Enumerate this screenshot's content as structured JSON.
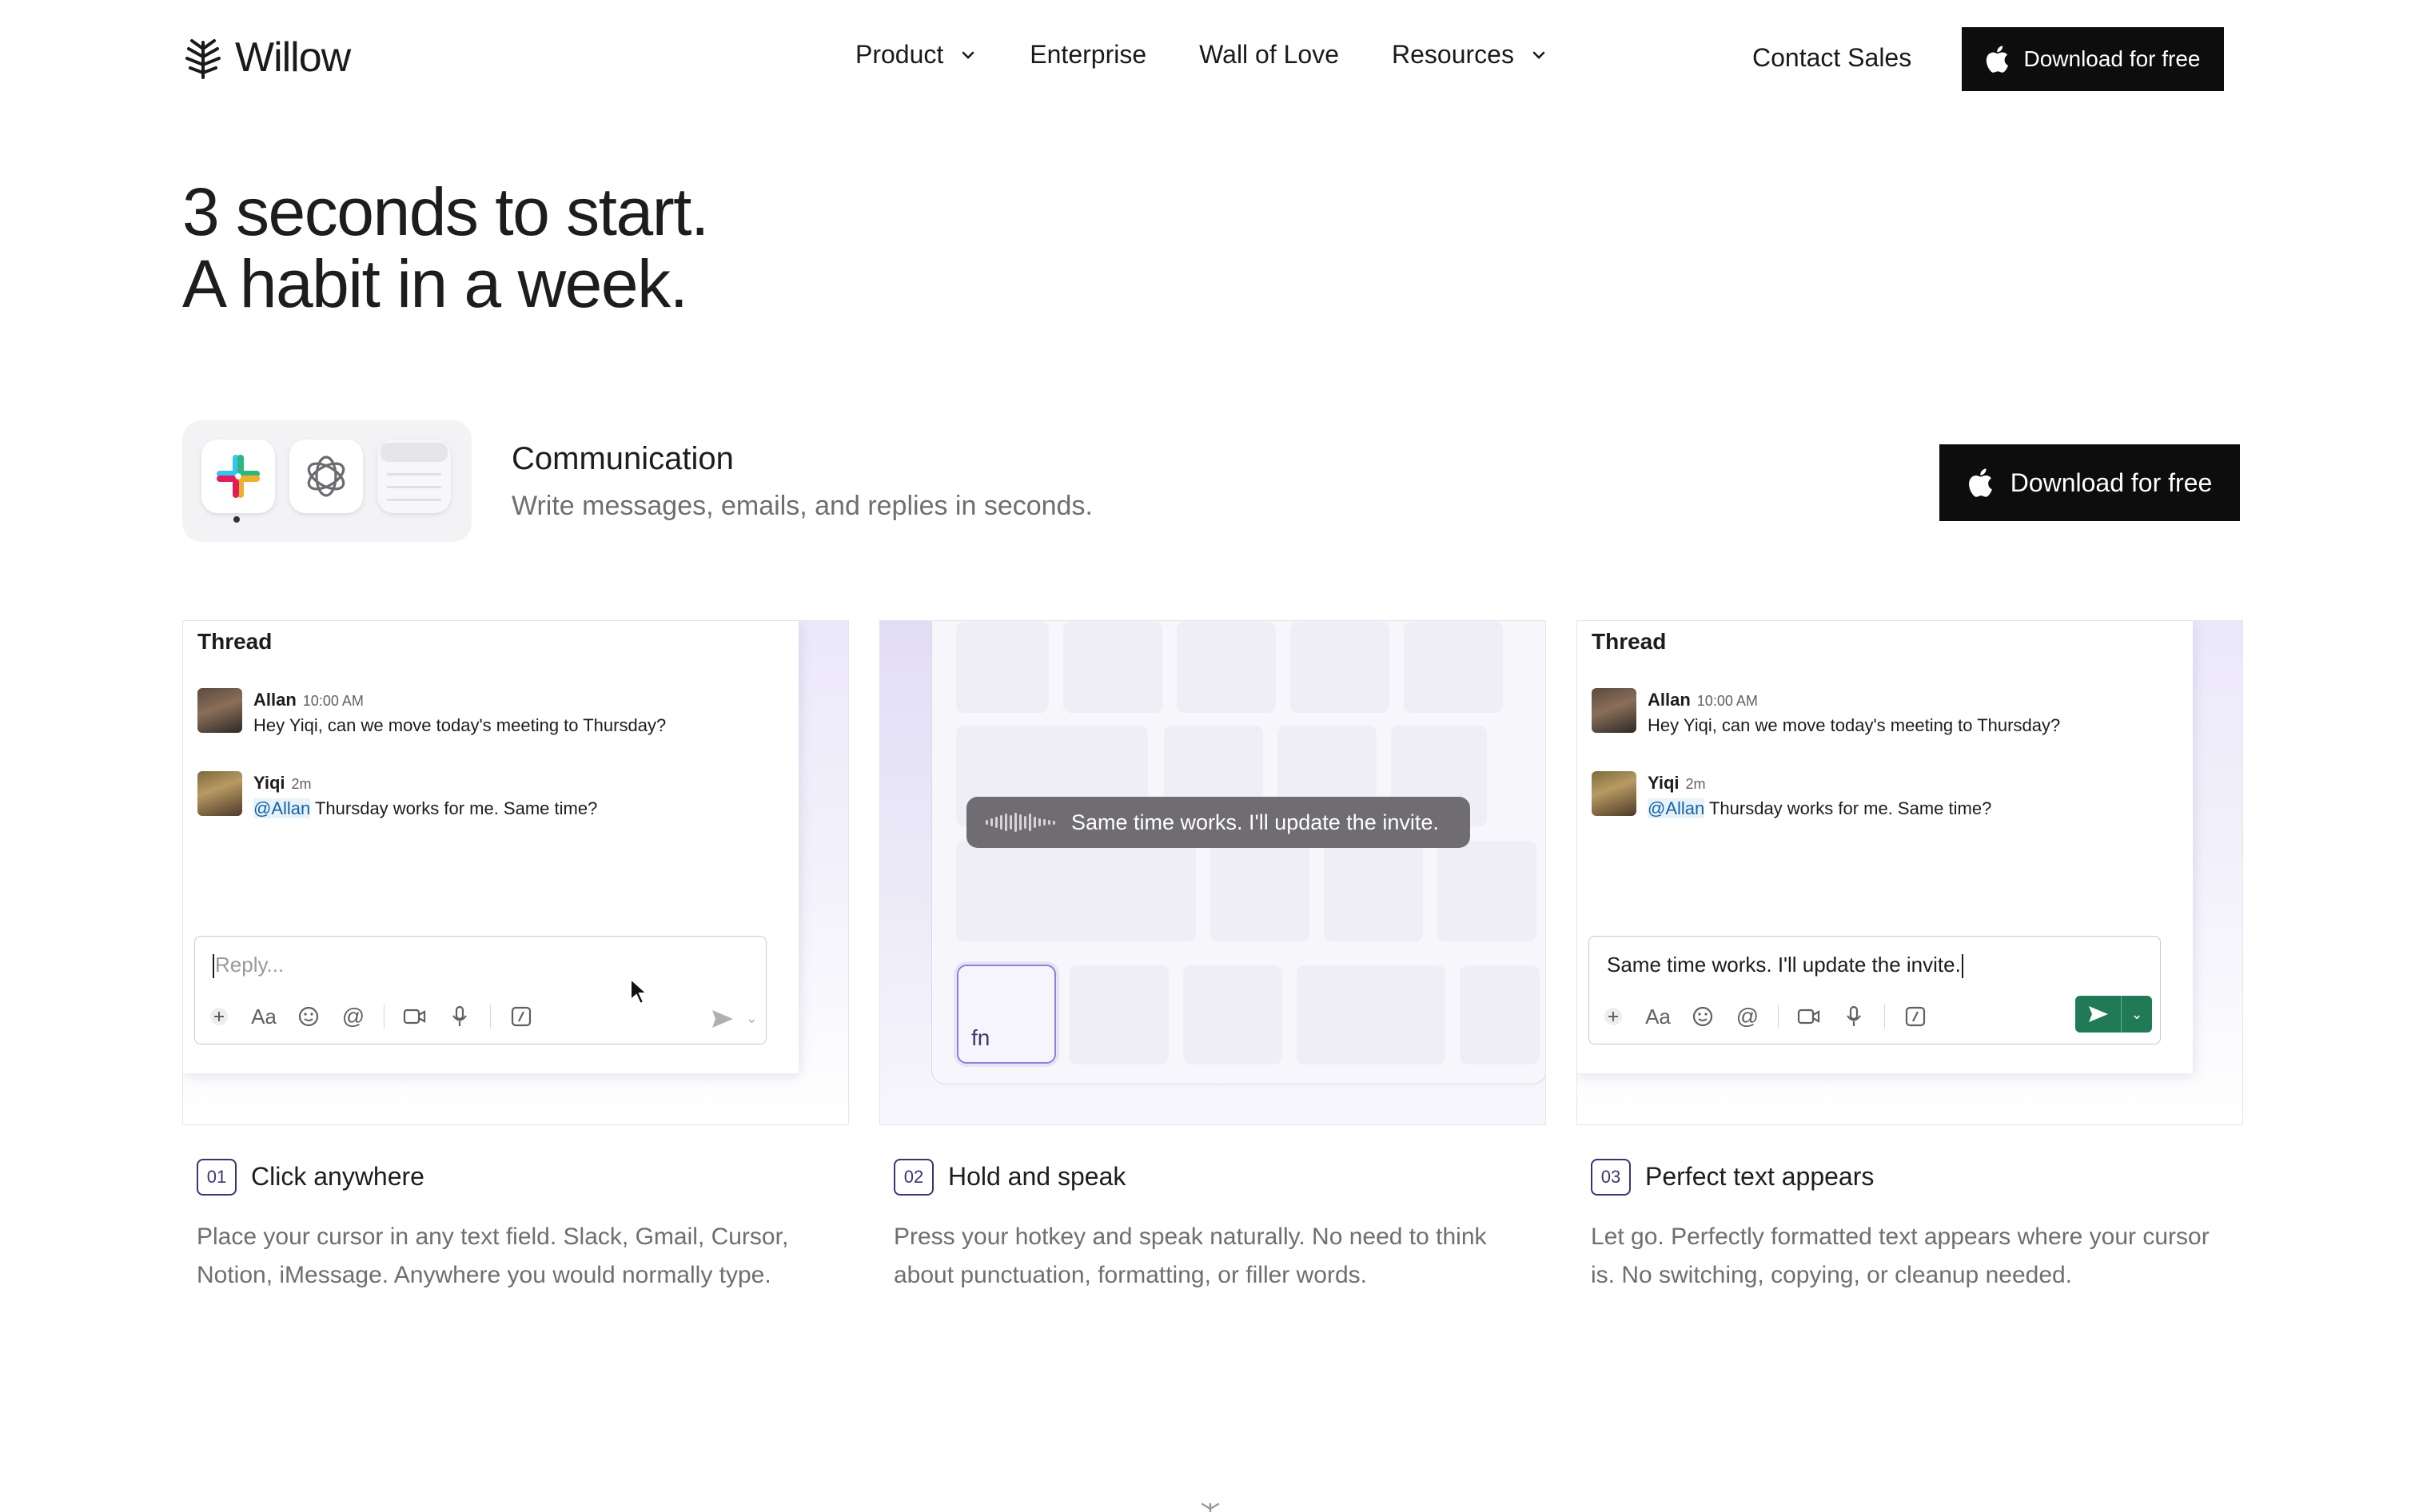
{
  "nav": {
    "logo_text": "Willow",
    "links": [
      "Product",
      "Enterprise",
      "Wall of Love",
      "Resources"
    ],
    "contact": "Contact Sales",
    "download": "Download for free"
  },
  "hero": {
    "line1": "3 seconds to start.",
    "line2": "A habit in a week."
  },
  "feature": {
    "title": "Communication",
    "description": "Write messages, emails, and replies in seconds.",
    "download": "Download for free",
    "apps": [
      "slack-icon",
      "chatgpt-icon",
      "mail-app-icon"
    ]
  },
  "thread": {
    "title": "Thread",
    "msg1": {
      "name": "Allan",
      "time": "10:00 AM",
      "text": "Hey Yiqi, can we move today's meeting to Thursday?"
    },
    "msg2": {
      "name": "Yiqi",
      "time": "2m",
      "mention": "@Allan",
      "text": " Thursday works for me. Same time?"
    },
    "reply_placeholder": "Reply...",
    "reply_filled": "Same time works. I'll update the invite."
  },
  "voice": {
    "transcript": "Same time works. I'll update the invite.",
    "hotkey": "fn"
  },
  "steps": [
    {
      "num": "01",
      "title": "Click anywhere",
      "desc": "Place your cursor in any text field. Slack, Gmail, Cursor, Notion, iMessage. Anywhere you would normally type."
    },
    {
      "num": "02",
      "title": "Hold and speak",
      "desc": "Press your hotkey and speak naturally. No need to think about punctuation, formatting, or filler words."
    },
    {
      "num": "03",
      "title": "Perfect text appears",
      "desc": "Let go. Perfectly formatted text appears where your cursor is. No switching, copying, or cleanup needed."
    }
  ],
  "colors": {
    "accent_dark": "#0d0d0d",
    "send_green": "#1f7a55",
    "mention_blue": "#1264a3",
    "step_outline": "#3a3570"
  }
}
